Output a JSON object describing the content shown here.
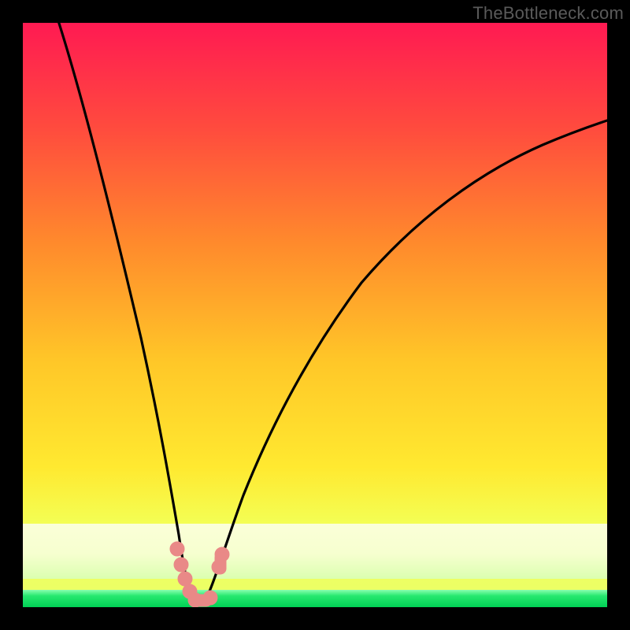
{
  "watermark": "TheBottleneck.com",
  "colors": {
    "top": "#ff1a52",
    "mid_upper": "#ff7a2e",
    "mid": "#ffd228",
    "mid_lower": "#f7ff60",
    "band_pale": "#fbffd0",
    "green": "#00e25a",
    "curve": "#000000",
    "marker": "#e98987",
    "frame_bg": "#000000"
  },
  "chart_data": {
    "type": "line",
    "title": "",
    "xlabel": "",
    "ylabel": "",
    "xlim": [
      0,
      100
    ],
    "ylim": [
      0,
      100
    ],
    "series": [
      {
        "name": "bottleneck-curve",
        "x": [
          0,
          4,
          8,
          12,
          16,
          20,
          22,
          24,
          26,
          27,
          28,
          29,
          30,
          31,
          33,
          36,
          40,
          45,
          50,
          55,
          60,
          66,
          72,
          80,
          88,
          95,
          100
        ],
        "y": [
          108,
          96,
          84,
          72,
          58,
          40,
          30,
          20,
          11,
          6,
          2,
          0,
          0,
          2,
          7,
          15,
          25,
          36,
          45,
          52,
          58,
          64,
          69,
          75,
          80,
          83,
          85
        ]
      }
    ],
    "markers": [
      {
        "x": 26.3,
        "y": 8.0
      },
      {
        "x": 26.9,
        "y": 5.0
      },
      {
        "x": 27.6,
        "y": 2.5
      },
      {
        "x": 28.5,
        "y": 0.8
      },
      {
        "x": 29.6,
        "y": 0.3
      },
      {
        "x": 30.8,
        "y": 0.5
      },
      {
        "x": 31.8,
        "y": 2.0
      },
      {
        "x": 33.0,
        "y": 6.0
      },
      {
        "x": 33.5,
        "y": 8.3
      }
    ],
    "green_band_y": 1.0,
    "pale_band_y": 12,
    "notch_x": 29.7
  }
}
